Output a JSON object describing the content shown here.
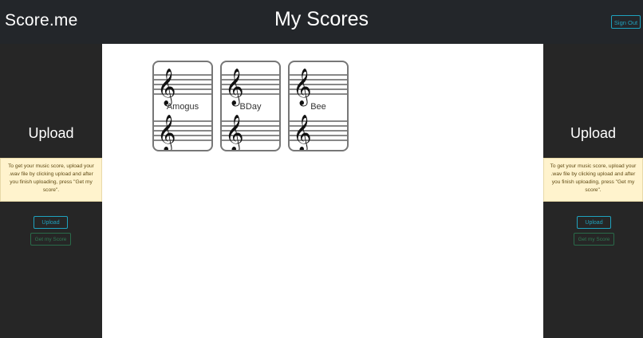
{
  "header": {
    "brand": "Score.me",
    "title": "My Scores",
    "signout_label": "Sign Out"
  },
  "left_panel": {
    "title": "Upload",
    "info": "To get your music score, upload your .wav file by clicking upload and after you finish uploading, press \"Get my score\".",
    "upload_label": "Upload",
    "get_score_label": "Get my Score"
  },
  "right_panel": {
    "title": "Upload",
    "info": "To get your music score, upload your .wav file by clicking upload and after you finish uploading, press \"Get my score\".",
    "upload_label": "Upload",
    "get_score_label": "Get my Score"
  },
  "scores": [
    {
      "name": "Amogus"
    },
    {
      "name": "BDay"
    },
    {
      "name": "Bee"
    }
  ],
  "colors": {
    "accent": "#1fa2be",
    "success": "#2f7a52",
    "warning_bg": "#fff3cd",
    "dark_bg": "#262626"
  },
  "icons": {
    "score_card": "treble-clef-staff-icon"
  }
}
